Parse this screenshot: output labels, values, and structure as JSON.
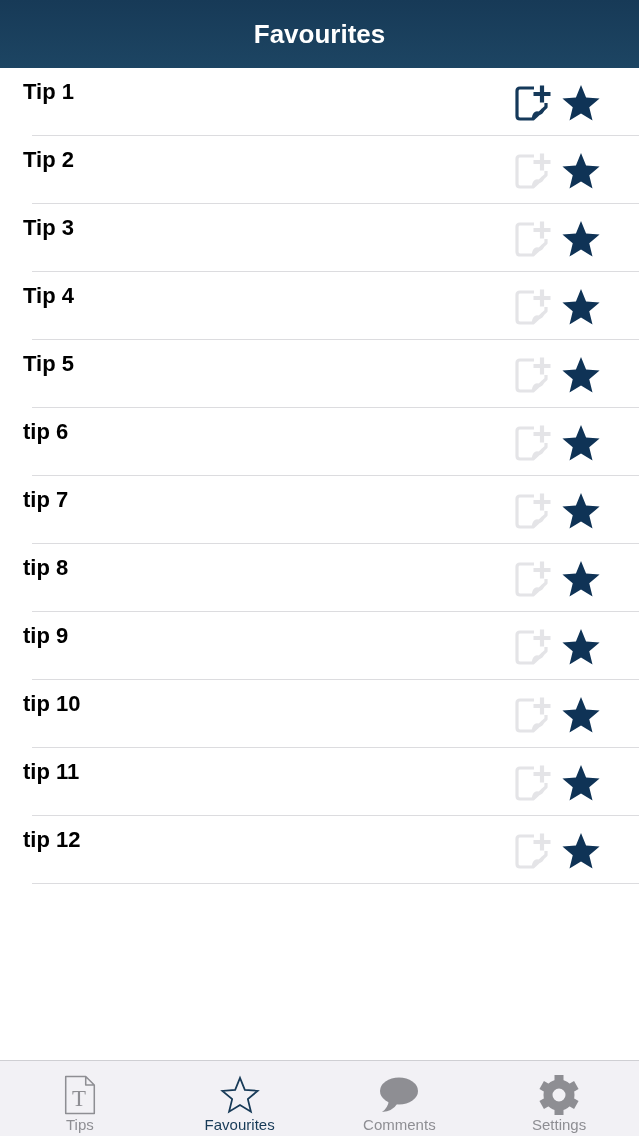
{
  "header": {
    "title": "Favourites"
  },
  "rows": [
    {
      "name": "Tip 1",
      "note_active": true,
      "favourite": true
    },
    {
      "name": "Tip 2",
      "note_active": false,
      "favourite": true
    },
    {
      "name": "Tip 3",
      "note_active": false,
      "favourite": true
    },
    {
      "name": "Tip 4",
      "note_active": false,
      "favourite": true
    },
    {
      "name": "Tip 5",
      "note_active": false,
      "favourite": true
    },
    {
      "name": "tip 6",
      "note_active": false,
      "favourite": true
    },
    {
      "name": "tip 7",
      "note_active": false,
      "favourite": true
    },
    {
      "name": "tip 8",
      "note_active": false,
      "favourite": true
    },
    {
      "name": "tip 9",
      "note_active": false,
      "favourite": true
    },
    {
      "name": "tip 10",
      "note_active": false,
      "favourite": true
    },
    {
      "name": "tip 11",
      "note_active": false,
      "favourite": true
    },
    {
      "name": "tip 12",
      "note_active": false,
      "favourite": true
    }
  ],
  "tab_bar": [
    {
      "kind": "tips",
      "label": "Tips",
      "icon_letter": "T",
      "selected": false
    },
    {
      "kind": "favourites",
      "label": "Favourites",
      "selected": true
    },
    {
      "kind": "comments",
      "label": "Comments",
      "selected": false
    },
    {
      "kind": "settings",
      "label": "Settings",
      "selected": false
    }
  ]
}
